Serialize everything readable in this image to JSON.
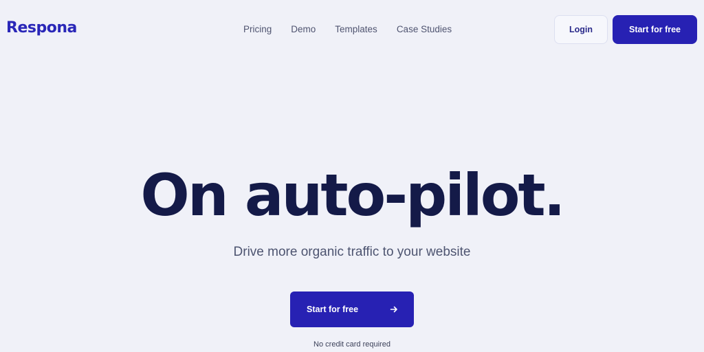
{
  "brand": {
    "name": "Respona",
    "accent_color": "#2721b3",
    "background_color": "#f0f1f8"
  },
  "nav": {
    "links": [
      "Pricing",
      "Demo",
      "Templates",
      "Case Studies"
    ]
  },
  "header": {
    "login_label": "Login",
    "cta_label": "Start for free"
  },
  "hero": {
    "title": "On auto-pilot.",
    "subtitle": "Drive more organic traffic to your website",
    "cta_label": "Start for free",
    "cta_icon": "arrow-right-icon",
    "note": "No credit card required"
  }
}
